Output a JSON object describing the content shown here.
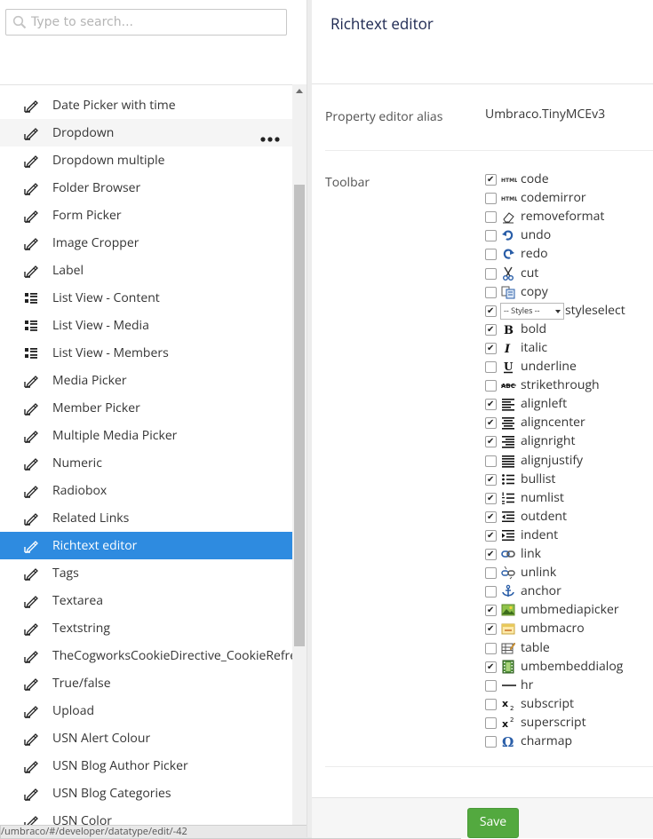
{
  "search": {
    "placeholder": "Type to search..."
  },
  "tree": {
    "items": [
      {
        "label": "Date Picker with time",
        "icon": "edit-icon"
      },
      {
        "label": "Dropdown",
        "icon": "edit-icon"
      },
      {
        "label": "Dropdown multiple",
        "icon": "edit-icon"
      },
      {
        "label": "Folder Browser",
        "icon": "edit-icon"
      },
      {
        "label": "Form Picker",
        "icon": "edit-icon"
      },
      {
        "label": "Image Cropper",
        "icon": "edit-icon"
      },
      {
        "label": "Label",
        "icon": "edit-icon"
      },
      {
        "label": "List View - Content",
        "icon": "list-icon"
      },
      {
        "label": "List View - Media",
        "icon": "list-icon"
      },
      {
        "label": "List View - Members",
        "icon": "list-icon"
      },
      {
        "label": "Media Picker",
        "icon": "edit-icon"
      },
      {
        "label": "Member Picker",
        "icon": "edit-icon"
      },
      {
        "label": "Multiple Media Picker",
        "icon": "edit-icon"
      },
      {
        "label": "Numeric",
        "icon": "edit-icon"
      },
      {
        "label": "Radiobox",
        "icon": "edit-icon"
      },
      {
        "label": "Related Links",
        "icon": "edit-icon"
      },
      {
        "label": "Richtext editor",
        "icon": "edit-icon"
      },
      {
        "label": "Tags",
        "icon": "edit-icon"
      },
      {
        "label": "Textarea",
        "icon": "edit-icon"
      },
      {
        "label": "Textstring",
        "icon": "edit-icon"
      },
      {
        "label": "TheCogworksCookieDirective_CookieRefre",
        "icon": "edit-icon"
      },
      {
        "label": "True/false",
        "icon": "edit-icon"
      },
      {
        "label": "Upload",
        "icon": "edit-icon"
      },
      {
        "label": "USN Alert Colour",
        "icon": "edit-icon"
      },
      {
        "label": "USN Blog Author Picker",
        "icon": "edit-icon"
      },
      {
        "label": "USN Blog Categories",
        "icon": "edit-icon"
      },
      {
        "label": "USN Color",
        "icon": "edit-icon"
      }
    ],
    "hover_item": "Dropdown",
    "active_item": "Richtext editor"
  },
  "statusbar": {
    "url": "/umbraco/#/developer/datatype/edit/-42"
  },
  "header": {
    "title": "Richtext editor"
  },
  "properties": {
    "alias_label": "Property editor alias",
    "alias_value": "Umbraco.TinyMCEv3",
    "toolbar_label": "Toolbar"
  },
  "toolbar_options": [
    {
      "label": "code",
      "checked": true,
      "icon": "html-icon"
    },
    {
      "label": "codemirror",
      "checked": false,
      "icon": "html-icon"
    },
    {
      "label": "removeformat",
      "checked": false,
      "icon": "eraser-icon"
    },
    {
      "label": "undo",
      "checked": false,
      "icon": "undo-icon"
    },
    {
      "label": "redo",
      "checked": false,
      "icon": "redo-icon"
    },
    {
      "label": "cut",
      "checked": false,
      "icon": "scissors-icon"
    },
    {
      "label": "copy",
      "checked": false,
      "icon": "copy-icon"
    },
    {
      "label": "styleselect",
      "checked": true,
      "icon": "styles-dropdown",
      "dropdown_text": "-- Styles --"
    },
    {
      "label": "bold",
      "checked": true,
      "icon": "bold-icon"
    },
    {
      "label": "italic",
      "checked": true,
      "icon": "italic-icon"
    },
    {
      "label": "underline",
      "checked": false,
      "icon": "underline-icon"
    },
    {
      "label": "strikethrough",
      "checked": false,
      "icon": "strikethrough-icon"
    },
    {
      "label": "alignleft",
      "checked": true,
      "icon": "align-left-icon"
    },
    {
      "label": "aligncenter",
      "checked": true,
      "icon": "align-center-icon"
    },
    {
      "label": "alignright",
      "checked": true,
      "icon": "align-right-icon"
    },
    {
      "label": "alignjustify",
      "checked": false,
      "icon": "align-justify-icon"
    },
    {
      "label": "bullist",
      "checked": true,
      "icon": "bullet-list-icon"
    },
    {
      "label": "numlist",
      "checked": true,
      "icon": "numbered-list-icon"
    },
    {
      "label": "outdent",
      "checked": true,
      "icon": "outdent-icon"
    },
    {
      "label": "indent",
      "checked": true,
      "icon": "indent-icon"
    },
    {
      "label": "link",
      "checked": true,
      "icon": "link-icon"
    },
    {
      "label": "unlink",
      "checked": false,
      "icon": "unlink-icon"
    },
    {
      "label": "anchor",
      "checked": false,
      "icon": "anchor-icon"
    },
    {
      "label": "umbmediapicker",
      "checked": true,
      "icon": "image-icon"
    },
    {
      "label": "umbmacro",
      "checked": true,
      "icon": "macro-icon"
    },
    {
      "label": "table",
      "checked": false,
      "icon": "table-icon"
    },
    {
      "label": "umbembeddialog",
      "checked": true,
      "icon": "film-icon"
    },
    {
      "label": "hr",
      "checked": false,
      "icon": "hr-icon"
    },
    {
      "label": "subscript",
      "checked": false,
      "icon": "subscript-icon"
    },
    {
      "label": "superscript",
      "checked": false,
      "icon": "superscript-icon"
    },
    {
      "label": "charmap",
      "checked": false,
      "icon": "omega-icon"
    }
  ],
  "footer": {
    "save_label": "Save"
  },
  "colors": {
    "active": "#2e8be0",
    "save": "#53a93f",
    "title": "#1b264f"
  }
}
